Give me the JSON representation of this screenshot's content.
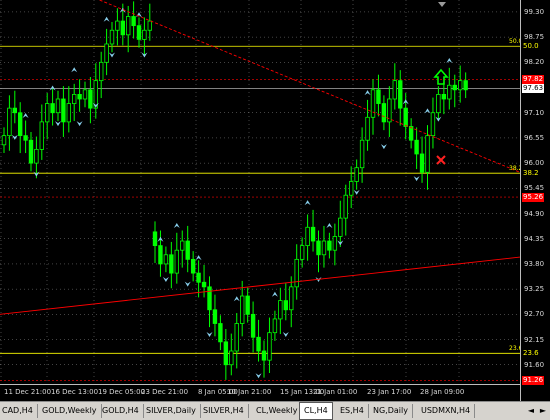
{
  "price_axis": {
    "ticks": [
      "99.30",
      "98.75",
      "98.20",
      "97.10",
      "96.55",
      "96.00",
      "95.45",
      "94.90",
      "94.35",
      "93.80",
      "93.25",
      "92.70",
      "92.15",
      "91.60"
    ],
    "tags": [
      {
        "label": "50.0",
        "color": "#ffff00",
        "bg": "#000000",
        "fg": "#ffff00"
      },
      {
        "label": "97.82",
        "color": "#ff0000",
        "bg": "#ff0000",
        "fg": "#ffffff"
      },
      {
        "label": "97.63",
        "color": "#ffffff",
        "bg": "#ffffff",
        "fg": "#000000"
      },
      {
        "label": "38.2",
        "color": "#ffff00",
        "bg": "#000000",
        "fg": "#ffff00"
      },
      {
        "label": "95.26",
        "color": "#ff0000",
        "bg": "#ff0000",
        "fg": "#ffffff"
      },
      {
        "label": "23.6",
        "color": "#ffff00",
        "bg": "#000000",
        "fg": "#ffff00"
      },
      {
        "label": "91.26",
        "color": "#ff0000",
        "bg": "#ff0000",
        "fg": "#ffffff"
      }
    ]
  },
  "time_axis": {
    "ticks": [
      "11 Dec 21:00",
      "16 Dec 13:00",
      "19 Dec 05:00",
      "23 Dec 21:00",
      "8 Jan 05:00",
      "10 Jan 21:00",
      "15 Jan 13:00",
      "21 Jan 01:00",
      "23 Jan 17:00",
      "28 Jan 09:00"
    ]
  },
  "fib_levels": [
    {
      "label": "50.0",
      "price": 98.55
    },
    {
      "label": "38.2",
      "price": 95.78
    },
    {
      "label": "23.6",
      "price": 91.85
    }
  ],
  "colors": {
    "up_candle": "#00ff00",
    "fractal_arrow": "#87ceeb",
    "trendline": "#ff0000",
    "level_line": "#ffff00",
    "grid": "#c0c0c0"
  },
  "icons": {
    "buy_signal": "up-arrow-icon",
    "stop_mark": "x-icon"
  },
  "tabs": {
    "items": [
      "CADCHF,H4",
      "GOLD,Weekly",
      "GOLD,H4",
      "SILVER,Daily",
      "SILVER,H4",
      "CL,Weekly",
      "CL,H4",
      "ES,H4",
      "NG,Daily",
      "USDMXN,H4"
    ],
    "active": "CL,H4",
    "first_visible_text": "CAD,H4"
  },
  "chart_data": {
    "type": "candlestick",
    "instrument": "CL",
    "timeframe": "H4",
    "ylim": [
      91.3,
      99.6
    ],
    "series_close": [
      96.6,
      97.2,
      97.1,
      96.6,
      96.5,
      96.0,
      96.3,
      96.9,
      97.3,
      97.1,
      97.4,
      96.9,
      97.3,
      97.5,
      97.4,
      97.6,
      97.2,
      97.8,
      98.2,
      98.6,
      98.9,
      99.1,
      98.8,
      99.2,
      99.0,
      98.7,
      98.9,
      99.1,
      94.2,
      93.8,
      94.0,
      93.6,
      94.1,
      94.3,
      93.9,
      93.6,
      93.4,
      93.3,
      92.8,
      92.5,
      92.1,
      91.6,
      91.9,
      92.5,
      93.1,
      92.7,
      92.2,
      91.9,
      91.7,
      92.3,
      92.6,
      93.0,
      92.8,
      93.3,
      93.9,
      94.2,
      94.6,
      94.3,
      94.0,
      94.3,
      94.1,
      94.4,
      94.8,
      95.3,
      95.6,
      95.9,
      96.5,
      97.0,
      97.6,
      97.3,
      96.9,
      97.4,
      97.8,
      97.2,
      96.8,
      96.5,
      96.2,
      95.8,
      96.6,
      97.1,
      97.5,
      97.4,
      97.7,
      97.6,
      97.8,
      97.6
    ],
    "annotations": [
      {
        "type": "trendline",
        "from_price": 99.6,
        "to_price": 95.8
      },
      {
        "type": "trendline",
        "from_price": 92.7,
        "to_price": 93.95
      },
      {
        "type": "level",
        "label": "50.0",
        "price": 98.55
      },
      {
        "type": "level",
        "label": "38.2",
        "price": 95.78
      },
      {
        "type": "level",
        "label": "23.6",
        "price": 91.85
      }
    ]
  }
}
